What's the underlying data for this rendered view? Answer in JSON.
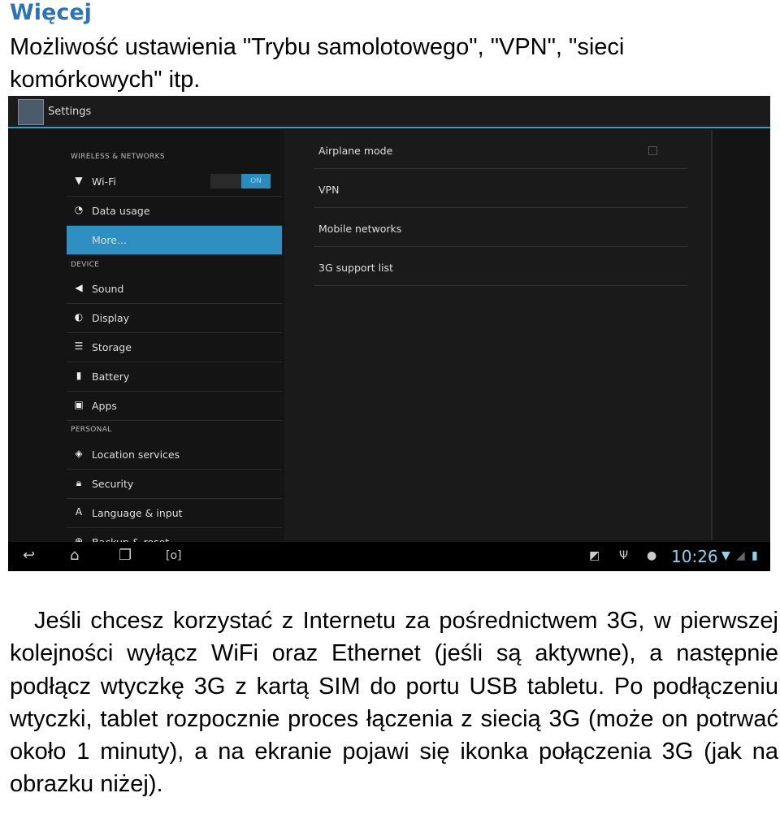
{
  "heading": "Więcej",
  "intro": " Możliwość ustawienia \"Trybu samolotowego\", \"VPN\", \"sieci komórkowych\" itp.",
  "screenshot": {
    "app_title": "Settings",
    "sections": {
      "wireless": "WIRELESS & NETWORKS",
      "device": "DEVICE",
      "personal": "PERSONAL"
    },
    "left_items": [
      {
        "label": "Wi-Fi",
        "icon": "wifi-icon",
        "toggle": "ON"
      },
      {
        "label": "Data usage",
        "icon": "data-usage-icon"
      },
      {
        "label": "More...",
        "selected": true
      },
      {
        "label": "Sound",
        "icon": "speaker-icon"
      },
      {
        "label": "Display",
        "icon": "display-icon"
      },
      {
        "label": "Storage",
        "icon": "storage-icon"
      },
      {
        "label": "Battery",
        "icon": "battery-icon"
      },
      {
        "label": "Apps",
        "icon": "apps-icon"
      },
      {
        "label": "Location services",
        "icon": "location-icon"
      },
      {
        "label": "Security",
        "icon": "lock-icon"
      },
      {
        "label": "Language & input",
        "icon": "language-icon"
      },
      {
        "label": "Backup & reset",
        "icon": "backup-icon"
      }
    ],
    "right_items": [
      {
        "label": "Airplane mode",
        "checked": false
      },
      {
        "label": "VPN"
      },
      {
        "label": "Mobile networks"
      },
      {
        "label": "3G support list"
      }
    ],
    "status": {
      "time": "10:26"
    },
    "accent": "#2e8fc0"
  },
  "body": "Jeśli chcesz korzystać z Internetu za pośrednictwem 3G, w pierwszej kolejności wyłącz WiFi oraz Ethernet (jeśli są aktywne), a następnie podłącz wtyczkę 3G z kartą SIM do portu USB tabletu.    Po podłączeniu wtyczki, tablet rozpocznie proces łączenia z siecią 3G (może on potrwać około 1 minuty), a na ekranie pojawi się ikonka połączenia 3G (jak na obrazku niżej)."
}
